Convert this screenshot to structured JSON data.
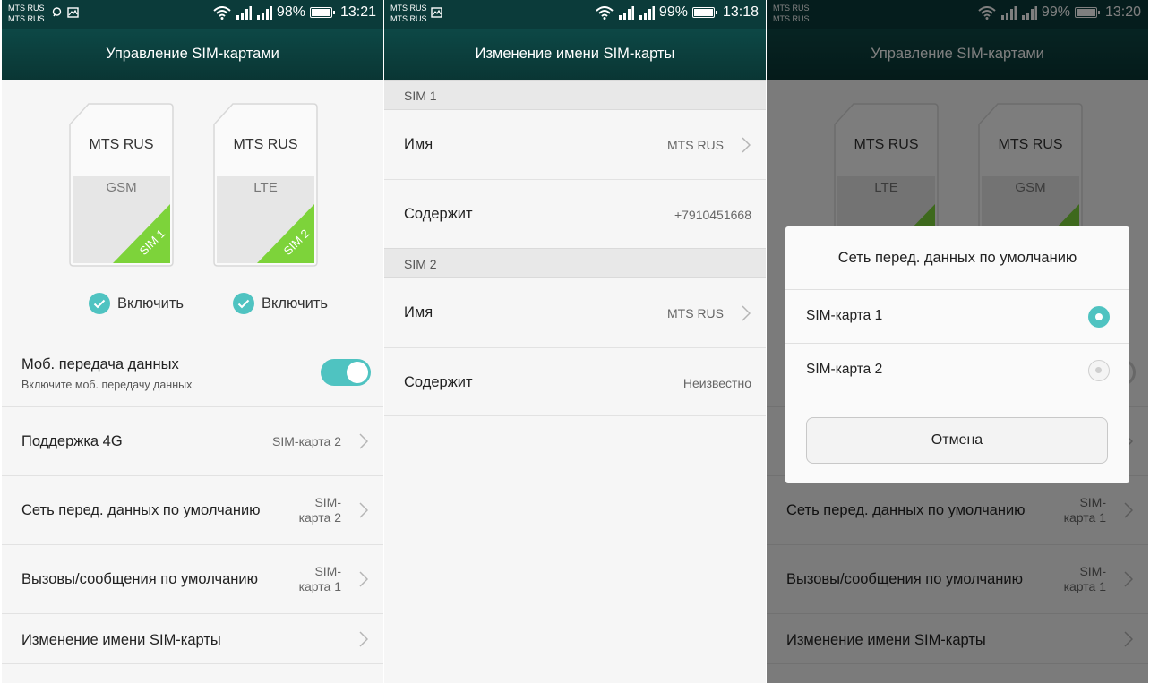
{
  "screen1": {
    "status": {
      "carrier1": "MTS RUS",
      "carrier2": "MTS RUS",
      "battery": "98%",
      "time": "13:21"
    },
    "title": "Управление SIM-картами",
    "sims": [
      {
        "carrier": "MTS RUS",
        "network": "GSM",
        "tag": "SIM 1",
        "enable_label": "Включить"
      },
      {
        "carrier": "MTS RUS",
        "network": "LTE",
        "tag": "SIM 2",
        "enable_label": "Включить"
      }
    ],
    "mobile_data": {
      "title": "Моб. передача данных",
      "subtitle": "Включите моб. передачу данных",
      "enabled": true
    },
    "rows": [
      {
        "title": "Поддержка 4G",
        "value_line1": "SIM-карта 2",
        "value_line2": ""
      },
      {
        "title": "Сеть перед. данных по умолчанию",
        "value_line1": "SIM-",
        "value_line2": "карта 2"
      },
      {
        "title": "Вызовы/сообщения по умолчанию",
        "value_line1": "SIM-",
        "value_line2": "карта 1"
      },
      {
        "title": "Изменение имени SIM-карты",
        "value_line1": "",
        "value_line2": ""
      }
    ]
  },
  "screen2": {
    "status": {
      "carrier1": "MTS RUS",
      "carrier2": "MTS RUS",
      "battery": "99%",
      "time": "13:18"
    },
    "title": "Изменение имени SIM-карты",
    "sections": [
      {
        "header": "SIM 1",
        "name_label": "Имя",
        "name_value": "MTS RUS",
        "number_label": "Содержит",
        "number_value": "+7910451668"
      },
      {
        "header": "SIM 2",
        "name_label": "Имя",
        "name_value": "MTS RUS",
        "number_label": "Содержит",
        "number_value": "Неизвестно"
      }
    ]
  },
  "screen3": {
    "status": {
      "carrier1": "MTS RUS",
      "carrier2": "MTS RUS",
      "battery": "99%",
      "time": "13:20"
    },
    "title": "Управление SIM-картами",
    "sims": [
      {
        "carrier": "MTS RUS",
        "network": "LTE"
      },
      {
        "carrier": "MTS RUS",
        "network": "GSM"
      }
    ],
    "rows": [
      {
        "title": "Сеть перед. данных по умолчанию",
        "value_line1": "SIM-",
        "value_line2": "карта 1"
      },
      {
        "title": "Вызовы/сообщения по умолчанию",
        "value_line1": "SIM-",
        "value_line2": "карта 1"
      },
      {
        "title": "Изменение имени SIM-карты"
      }
    ],
    "dialog": {
      "title": "Сеть перед. данных по умолчанию",
      "options": [
        {
          "label": "SIM-карта 1",
          "selected": true
        },
        {
          "label": "SIM-карта 2",
          "selected": false
        }
      ],
      "cancel_label": "Отмена"
    }
  },
  "colors": {
    "appbar": "#0b3b3a",
    "accent": "#4fc3c1",
    "sim_tag": "#7dd33a"
  }
}
